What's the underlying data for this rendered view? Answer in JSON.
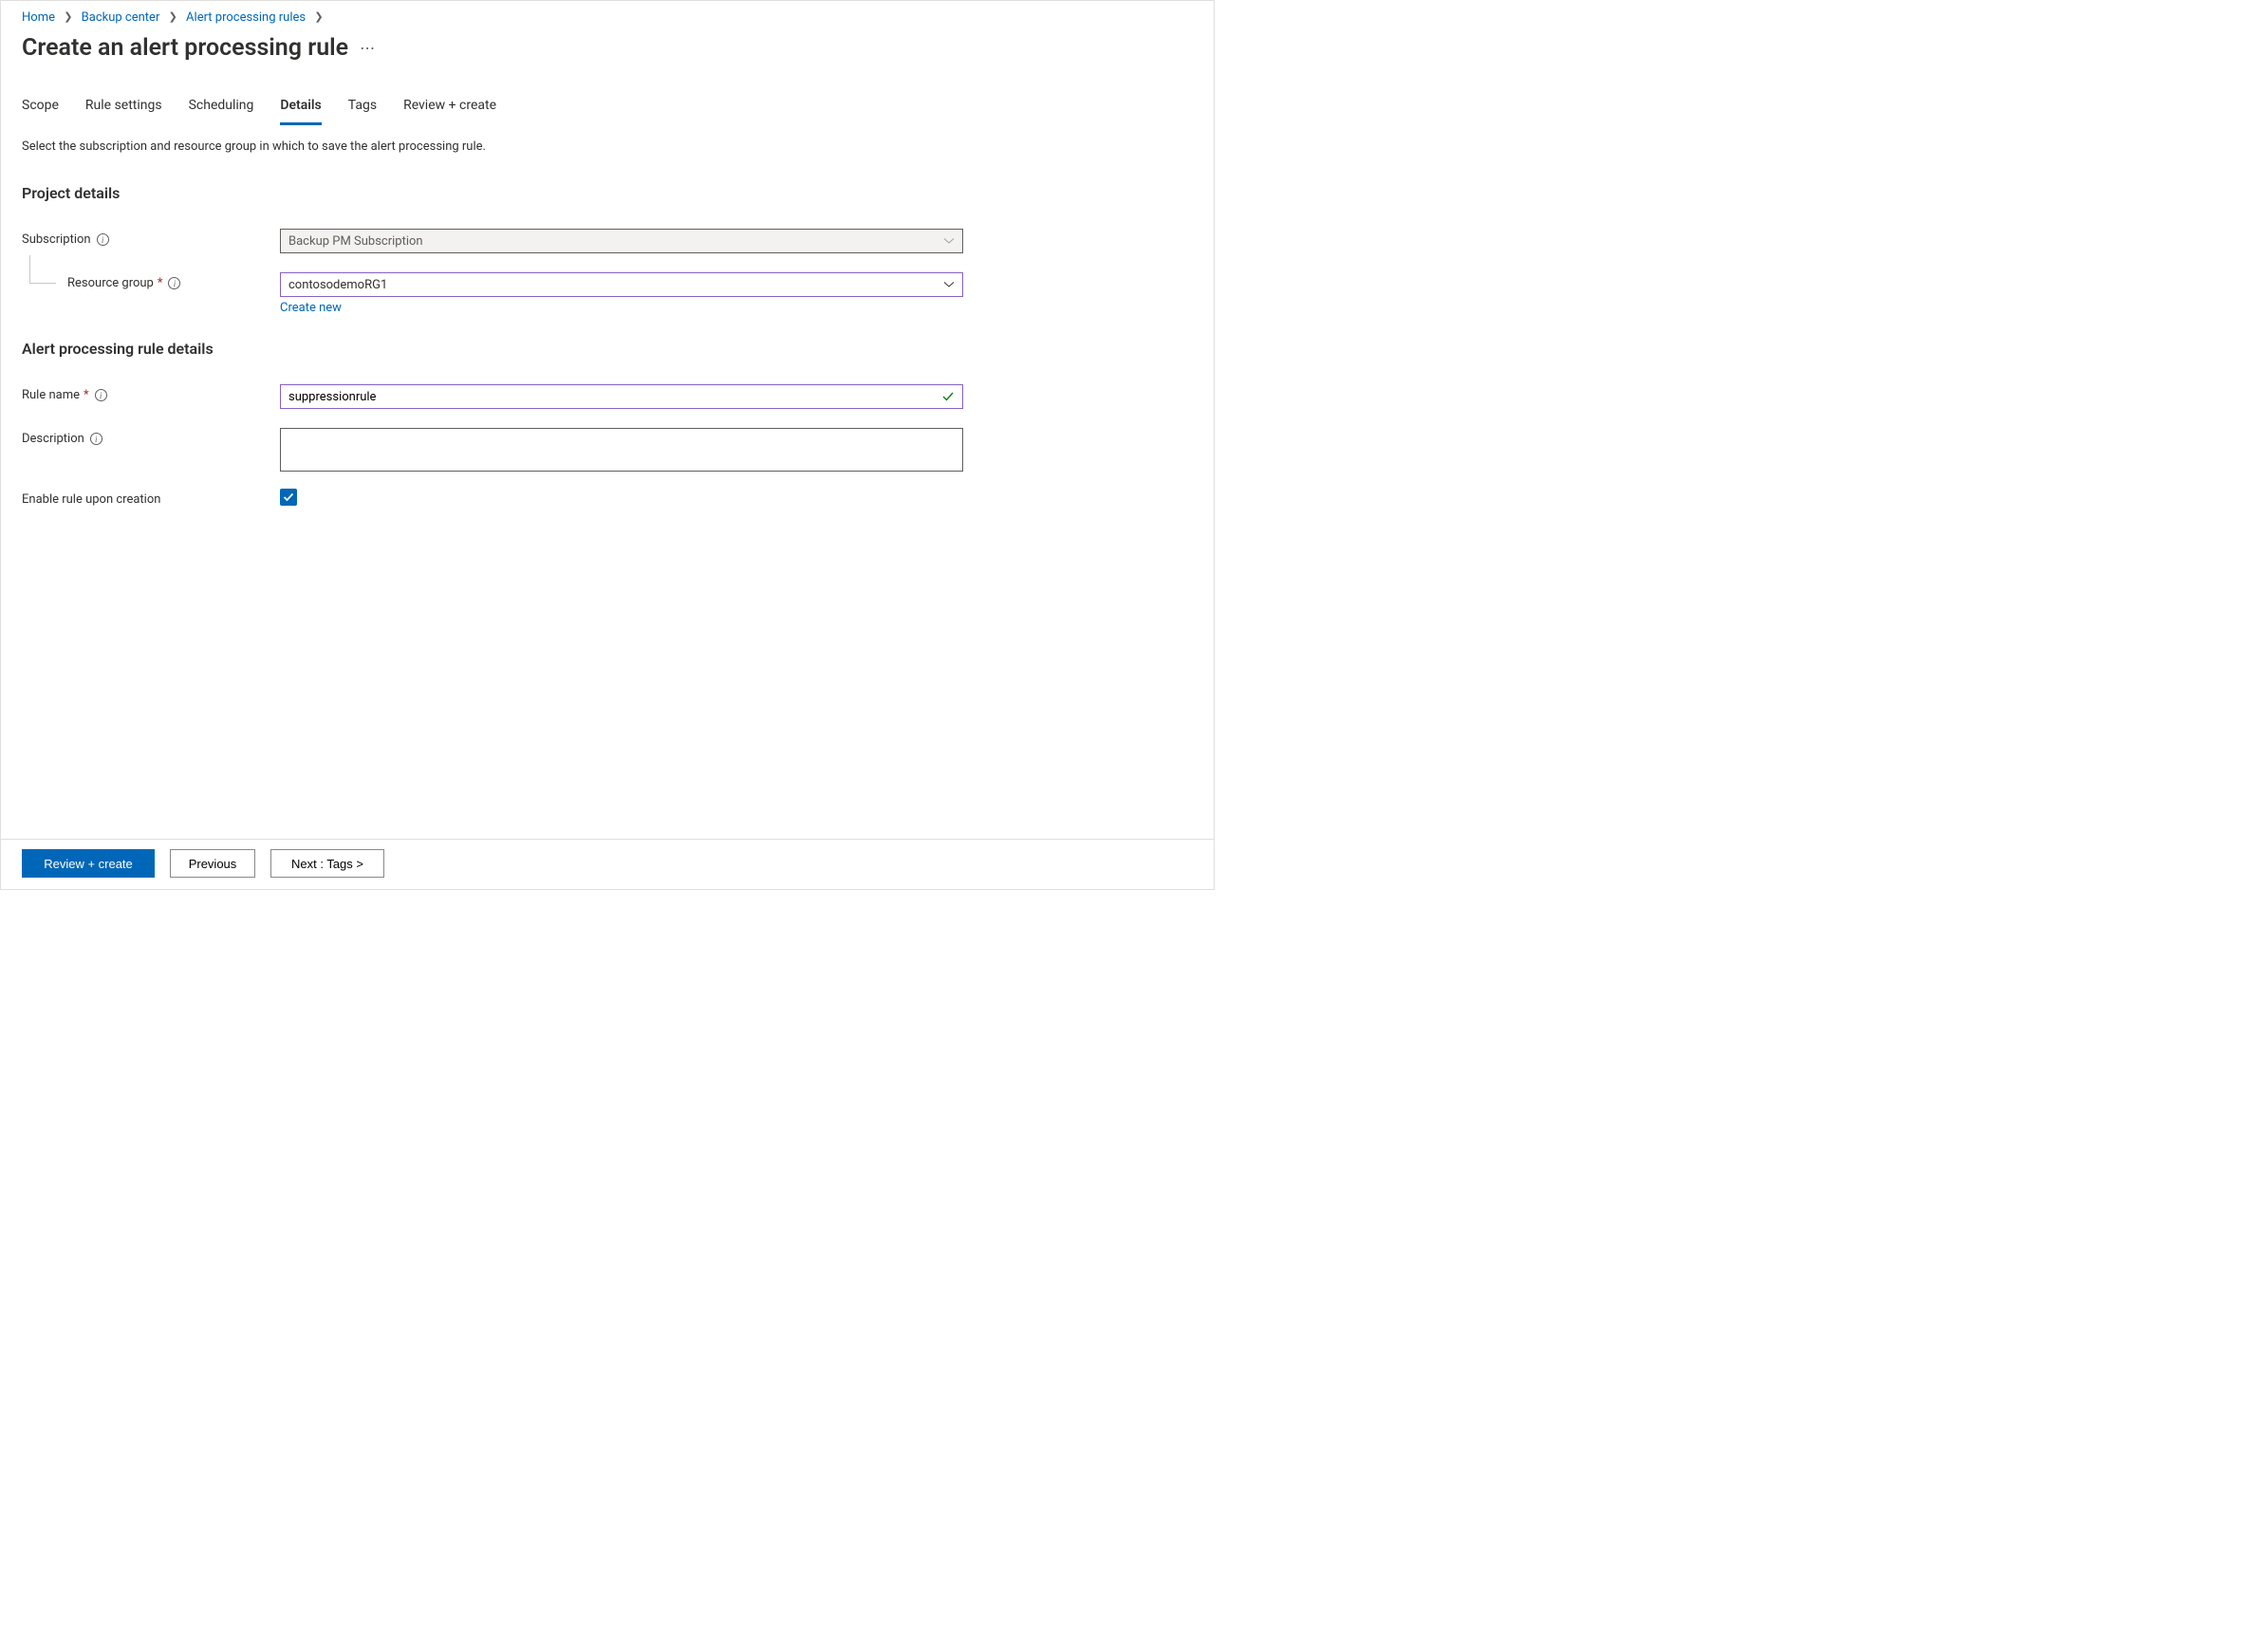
{
  "breadcrumb": {
    "items": [
      "Home",
      "Backup center",
      "Alert processing rules"
    ]
  },
  "title": "Create an alert processing rule",
  "tabs": [
    "Scope",
    "Rule settings",
    "Scheduling",
    "Details",
    "Tags",
    "Review + create"
  ],
  "tabs_selected_index": 3,
  "intro": "Select the subscription and resource group in which to save the alert processing rule.",
  "sections": {
    "project": {
      "heading": "Project details",
      "subscription_label": "Subscription",
      "subscription_value": "Backup PM Subscription",
      "resource_group_label": "Resource group",
      "resource_group_value": "contosodemoRG1",
      "create_new_label": "Create new"
    },
    "rule": {
      "heading": "Alert processing rule details",
      "rule_name_label": "Rule name",
      "rule_name_value": "suppressionrule",
      "description_label": "Description",
      "description_value": "",
      "enable_label": "Enable rule upon creation",
      "enable_checked": true
    }
  },
  "footer": {
    "review": "Review + create",
    "previous": "Previous",
    "next": "Next : Tags >"
  }
}
